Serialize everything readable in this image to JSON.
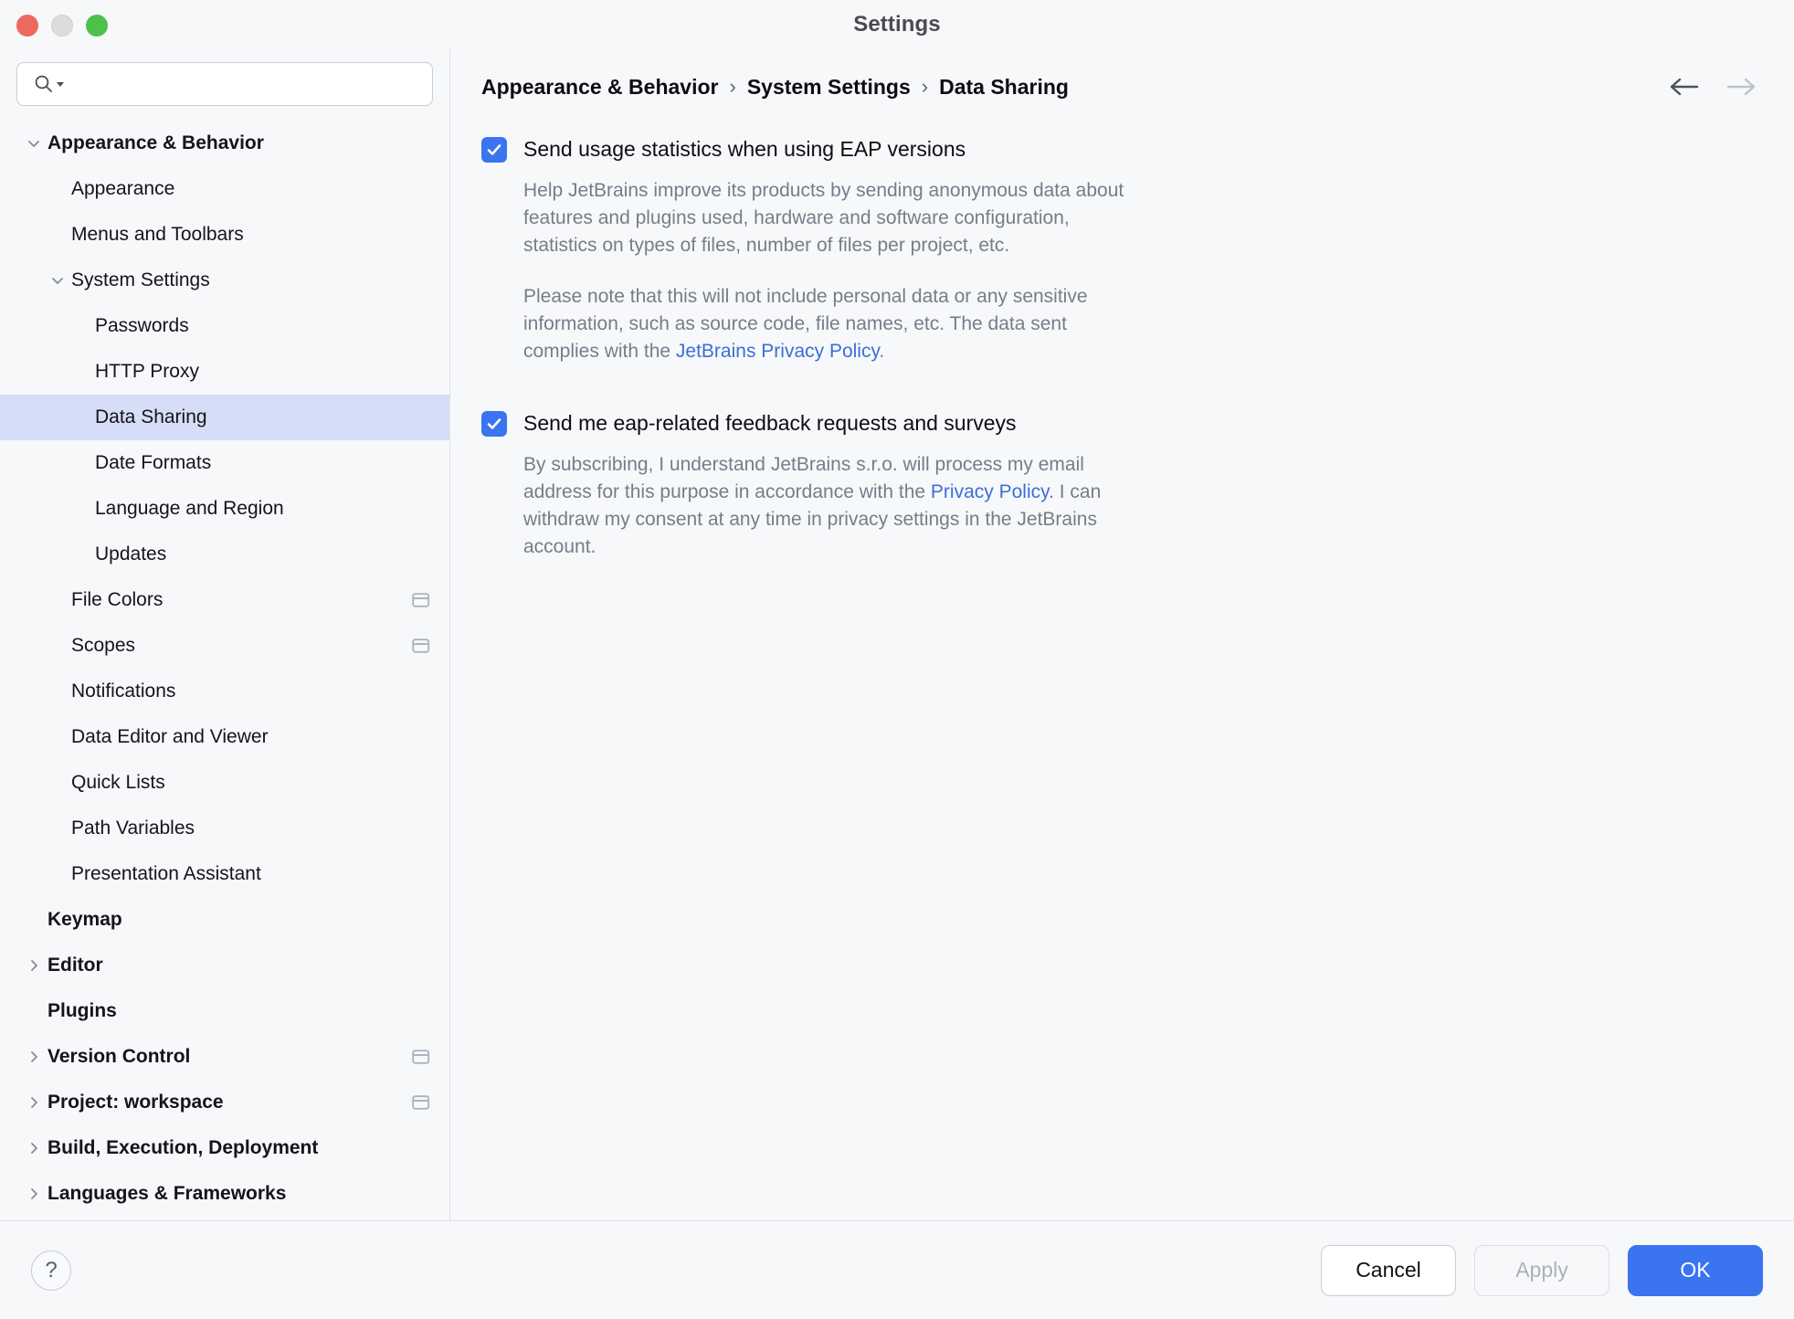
{
  "window": {
    "title": "Settings",
    "traffic_lights": [
      "close",
      "minimize",
      "maximize"
    ]
  },
  "search": {
    "value": "",
    "placeholder": "",
    "icon": "search-icon"
  },
  "sidebar": {
    "items": [
      {
        "label": "Appearance & Behavior",
        "indent": 0,
        "bold": true,
        "twisty": "expanded",
        "scope_icon": false
      },
      {
        "label": "Appearance",
        "indent": 1,
        "bold": false,
        "twisty": "none",
        "scope_icon": false
      },
      {
        "label": "Menus and Toolbars",
        "indent": 1,
        "bold": false,
        "twisty": "none",
        "scope_icon": false
      },
      {
        "label": "System Settings",
        "indent": 1,
        "bold": false,
        "twisty": "expanded",
        "scope_icon": false
      },
      {
        "label": "Passwords",
        "indent": 2,
        "bold": false,
        "twisty": "none",
        "scope_icon": false
      },
      {
        "label": "HTTP Proxy",
        "indent": 2,
        "bold": false,
        "twisty": "none",
        "scope_icon": false
      },
      {
        "label": "Data Sharing",
        "indent": 2,
        "bold": false,
        "twisty": "none",
        "scope_icon": false,
        "selected": true
      },
      {
        "label": "Date Formats",
        "indent": 2,
        "bold": false,
        "twisty": "none",
        "scope_icon": false
      },
      {
        "label": "Language and Region",
        "indent": 2,
        "bold": false,
        "twisty": "none",
        "scope_icon": false
      },
      {
        "label": "Updates",
        "indent": 2,
        "bold": false,
        "twisty": "none",
        "scope_icon": false
      },
      {
        "label": "File Colors",
        "indent": 1,
        "bold": false,
        "twisty": "none",
        "scope_icon": true
      },
      {
        "label": "Scopes",
        "indent": 1,
        "bold": false,
        "twisty": "none",
        "scope_icon": true
      },
      {
        "label": "Notifications",
        "indent": 1,
        "bold": false,
        "twisty": "none",
        "scope_icon": false
      },
      {
        "label": "Data Editor and Viewer",
        "indent": 1,
        "bold": false,
        "twisty": "none",
        "scope_icon": false
      },
      {
        "label": "Quick Lists",
        "indent": 1,
        "bold": false,
        "twisty": "none",
        "scope_icon": false
      },
      {
        "label": "Path Variables",
        "indent": 1,
        "bold": false,
        "twisty": "none",
        "scope_icon": false
      },
      {
        "label": "Presentation Assistant",
        "indent": 1,
        "bold": false,
        "twisty": "none",
        "scope_icon": false
      },
      {
        "label": "Keymap",
        "indent": 0,
        "bold": true,
        "twisty": "none",
        "scope_icon": false
      },
      {
        "label": "Editor",
        "indent": 0,
        "bold": true,
        "twisty": "collapsed",
        "scope_icon": false
      },
      {
        "label": "Plugins",
        "indent": 0,
        "bold": true,
        "twisty": "none",
        "scope_icon": false
      },
      {
        "label": "Version Control",
        "indent": 0,
        "bold": true,
        "twisty": "collapsed",
        "scope_icon": true
      },
      {
        "label": "Project: workspace",
        "indent": 0,
        "bold": true,
        "twisty": "collapsed",
        "scope_icon": true
      },
      {
        "label": "Build, Execution, Deployment",
        "indent": 0,
        "bold": true,
        "twisty": "collapsed",
        "scope_icon": false
      },
      {
        "label": "Languages & Frameworks",
        "indent": 0,
        "bold": true,
        "twisty": "collapsed",
        "scope_icon": false
      }
    ]
  },
  "main": {
    "breadcrumb": {
      "crumbs": [
        "Appearance & Behavior",
        "System Settings",
        "Data Sharing"
      ],
      "separator": "›"
    },
    "nav": {
      "back_label": "back-arrow",
      "forward_label": "forward-arrow"
    },
    "settings": [
      {
        "checkbox_label": "Send usage statistics when using EAP versions",
        "checked": true,
        "paragraphs": [
          {
            "text_before": "Help JetBrains improve its products by sending anonymous data about features and plugins used, hardware and software configuration, statistics on types of files, number of files per project, etc.",
            "link": "",
            "text_after": ""
          },
          {
            "text_before": "Please note that this will not include personal data or any sensitive information, such as source code, file names, etc. The data sent complies with the ",
            "link": "JetBrains Privacy Policy",
            "text_after": "."
          }
        ]
      },
      {
        "checkbox_label": "Send me eap-related feedback requests and surveys",
        "checked": true,
        "paragraphs": [
          {
            "text_before": "By subscribing, I understand JetBrains s.r.o. will process my email address for this purpose in accordance with the ",
            "link": "Privacy Policy",
            "text_after": ". I can withdraw my consent at any time in privacy settings in the JetBrains account."
          }
        ]
      }
    ]
  },
  "footer": {
    "help_label": "?",
    "cancel_label": "Cancel",
    "apply_label": "Apply",
    "ok_label": "OK"
  },
  "colors": {
    "accent": "#3b74f0",
    "selection": "#d6ddf6",
    "link": "#3a6fd8",
    "panel_bg": "#f7f8fa",
    "muted_text": "#787c8a",
    "traffic_close": "#ec6a5f",
    "traffic_min": "#dcdcdc",
    "traffic_max": "#4cc14c"
  }
}
